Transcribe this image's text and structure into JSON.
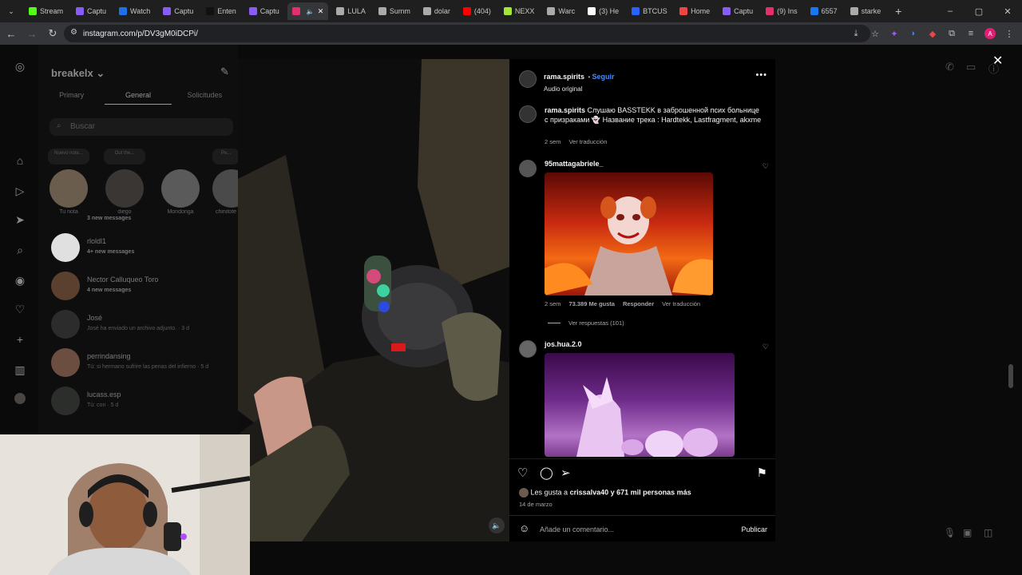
{
  "browser": {
    "tabs": [
      {
        "label": "Stream",
        "color": "#53fc18"
      },
      {
        "label": "Captu",
        "color": "#8a5cf6"
      },
      {
        "label": "Watch",
        "color": "#1f6feb"
      },
      {
        "label": "Captu",
        "color": "#8a5cf6"
      },
      {
        "label": "Enten",
        "color": "#111111"
      },
      {
        "label": "Captu",
        "color": "#8a5cf6"
      },
      {
        "label": "",
        "color": "#e1306c",
        "active": true
      },
      {
        "label": "LULA",
        "color": "#aaaaaa"
      },
      {
        "label": "Summ",
        "color": "#aaaaaa"
      },
      {
        "label": "dolar",
        "color": "#aaaaaa"
      },
      {
        "label": "(404)",
        "color": "#ff0000"
      },
      {
        "label": "NEXX",
        "color": "#a3e635"
      },
      {
        "label": "Warc",
        "color": "#aaaaaa"
      },
      {
        "label": "(3) He",
        "color": "#ffffff"
      },
      {
        "label": "BTCUS",
        "color": "#2962ff"
      },
      {
        "label": "Home",
        "color": "#ef4444"
      },
      {
        "label": "Captu",
        "color": "#8a5cf6"
      },
      {
        "label": "(9) Ins",
        "color": "#e1306c"
      },
      {
        "label": "6557",
        "color": "#1877f2"
      },
      {
        "label": "starke",
        "color": "#aaaaaa"
      }
    ],
    "url": "instagram.com/p/DV3gM0iDCPi/"
  },
  "dm": {
    "username": "breakelx",
    "tabs": [
      "Primary",
      "General",
      "Solicitudes"
    ],
    "search_placeholder": "Buscar",
    "notes": [
      {
        "bubble": "Nuevo\nnote...",
        "name": "Tu nota"
      },
      {
        "bubble": "Out the...",
        "name": "diego"
      },
      {
        "bubble": "",
        "name": "Mondonga"
      },
      {
        "bubble": "Pe...",
        "name": "chinitote"
      }
    ],
    "conversations": [
      {
        "name": "",
        "msg": "3 new messages",
        "unread": true
      },
      {
        "name": "rloldl1",
        "msg": "4+ new messages",
        "unread": true
      },
      {
        "name": "Nector Calluqueo Toro",
        "msg": "4 new messages",
        "unread": true
      },
      {
        "name": "José",
        "msg": "José ha enviado un archivo adjunto. · 3 d",
        "unread": false
      },
      {
        "name": "perrindansing",
        "msg": "Tú: si hermano sufrire las penas del infierno · 5 d",
        "unread": false
      },
      {
        "name": "lucass.esp",
        "msg": "Tú: con · 5 d",
        "unread": false
      }
    ]
  },
  "post": {
    "author": "rama.spirits",
    "follow": "Seguir",
    "audio": "Audio original",
    "caption": "Слушаю BASSTEKK в заброшенной псих больнице с призраками 👻 Название трека : Hardtekk, Lastfragment, akxme",
    "caption_time": "2 sem",
    "caption_translate": "Ver traducción",
    "comments": [
      {
        "user": "95mattagabriele_",
        "time": "2 sem",
        "likes": "73.389 Me gusta",
        "reply": "Responder",
        "translate": "Ver traducción",
        "replies": "Ver respuestas (101)"
      },
      {
        "user": "jos.hua.2.0"
      }
    ],
    "liked_by": "Les gusta a ",
    "liked_user": "crissalva40",
    "liked_rest": " y 671 mil personas más",
    "date": "14 de marzo",
    "comment_placeholder": "Añade un comentario...",
    "publish": "Publicar"
  }
}
